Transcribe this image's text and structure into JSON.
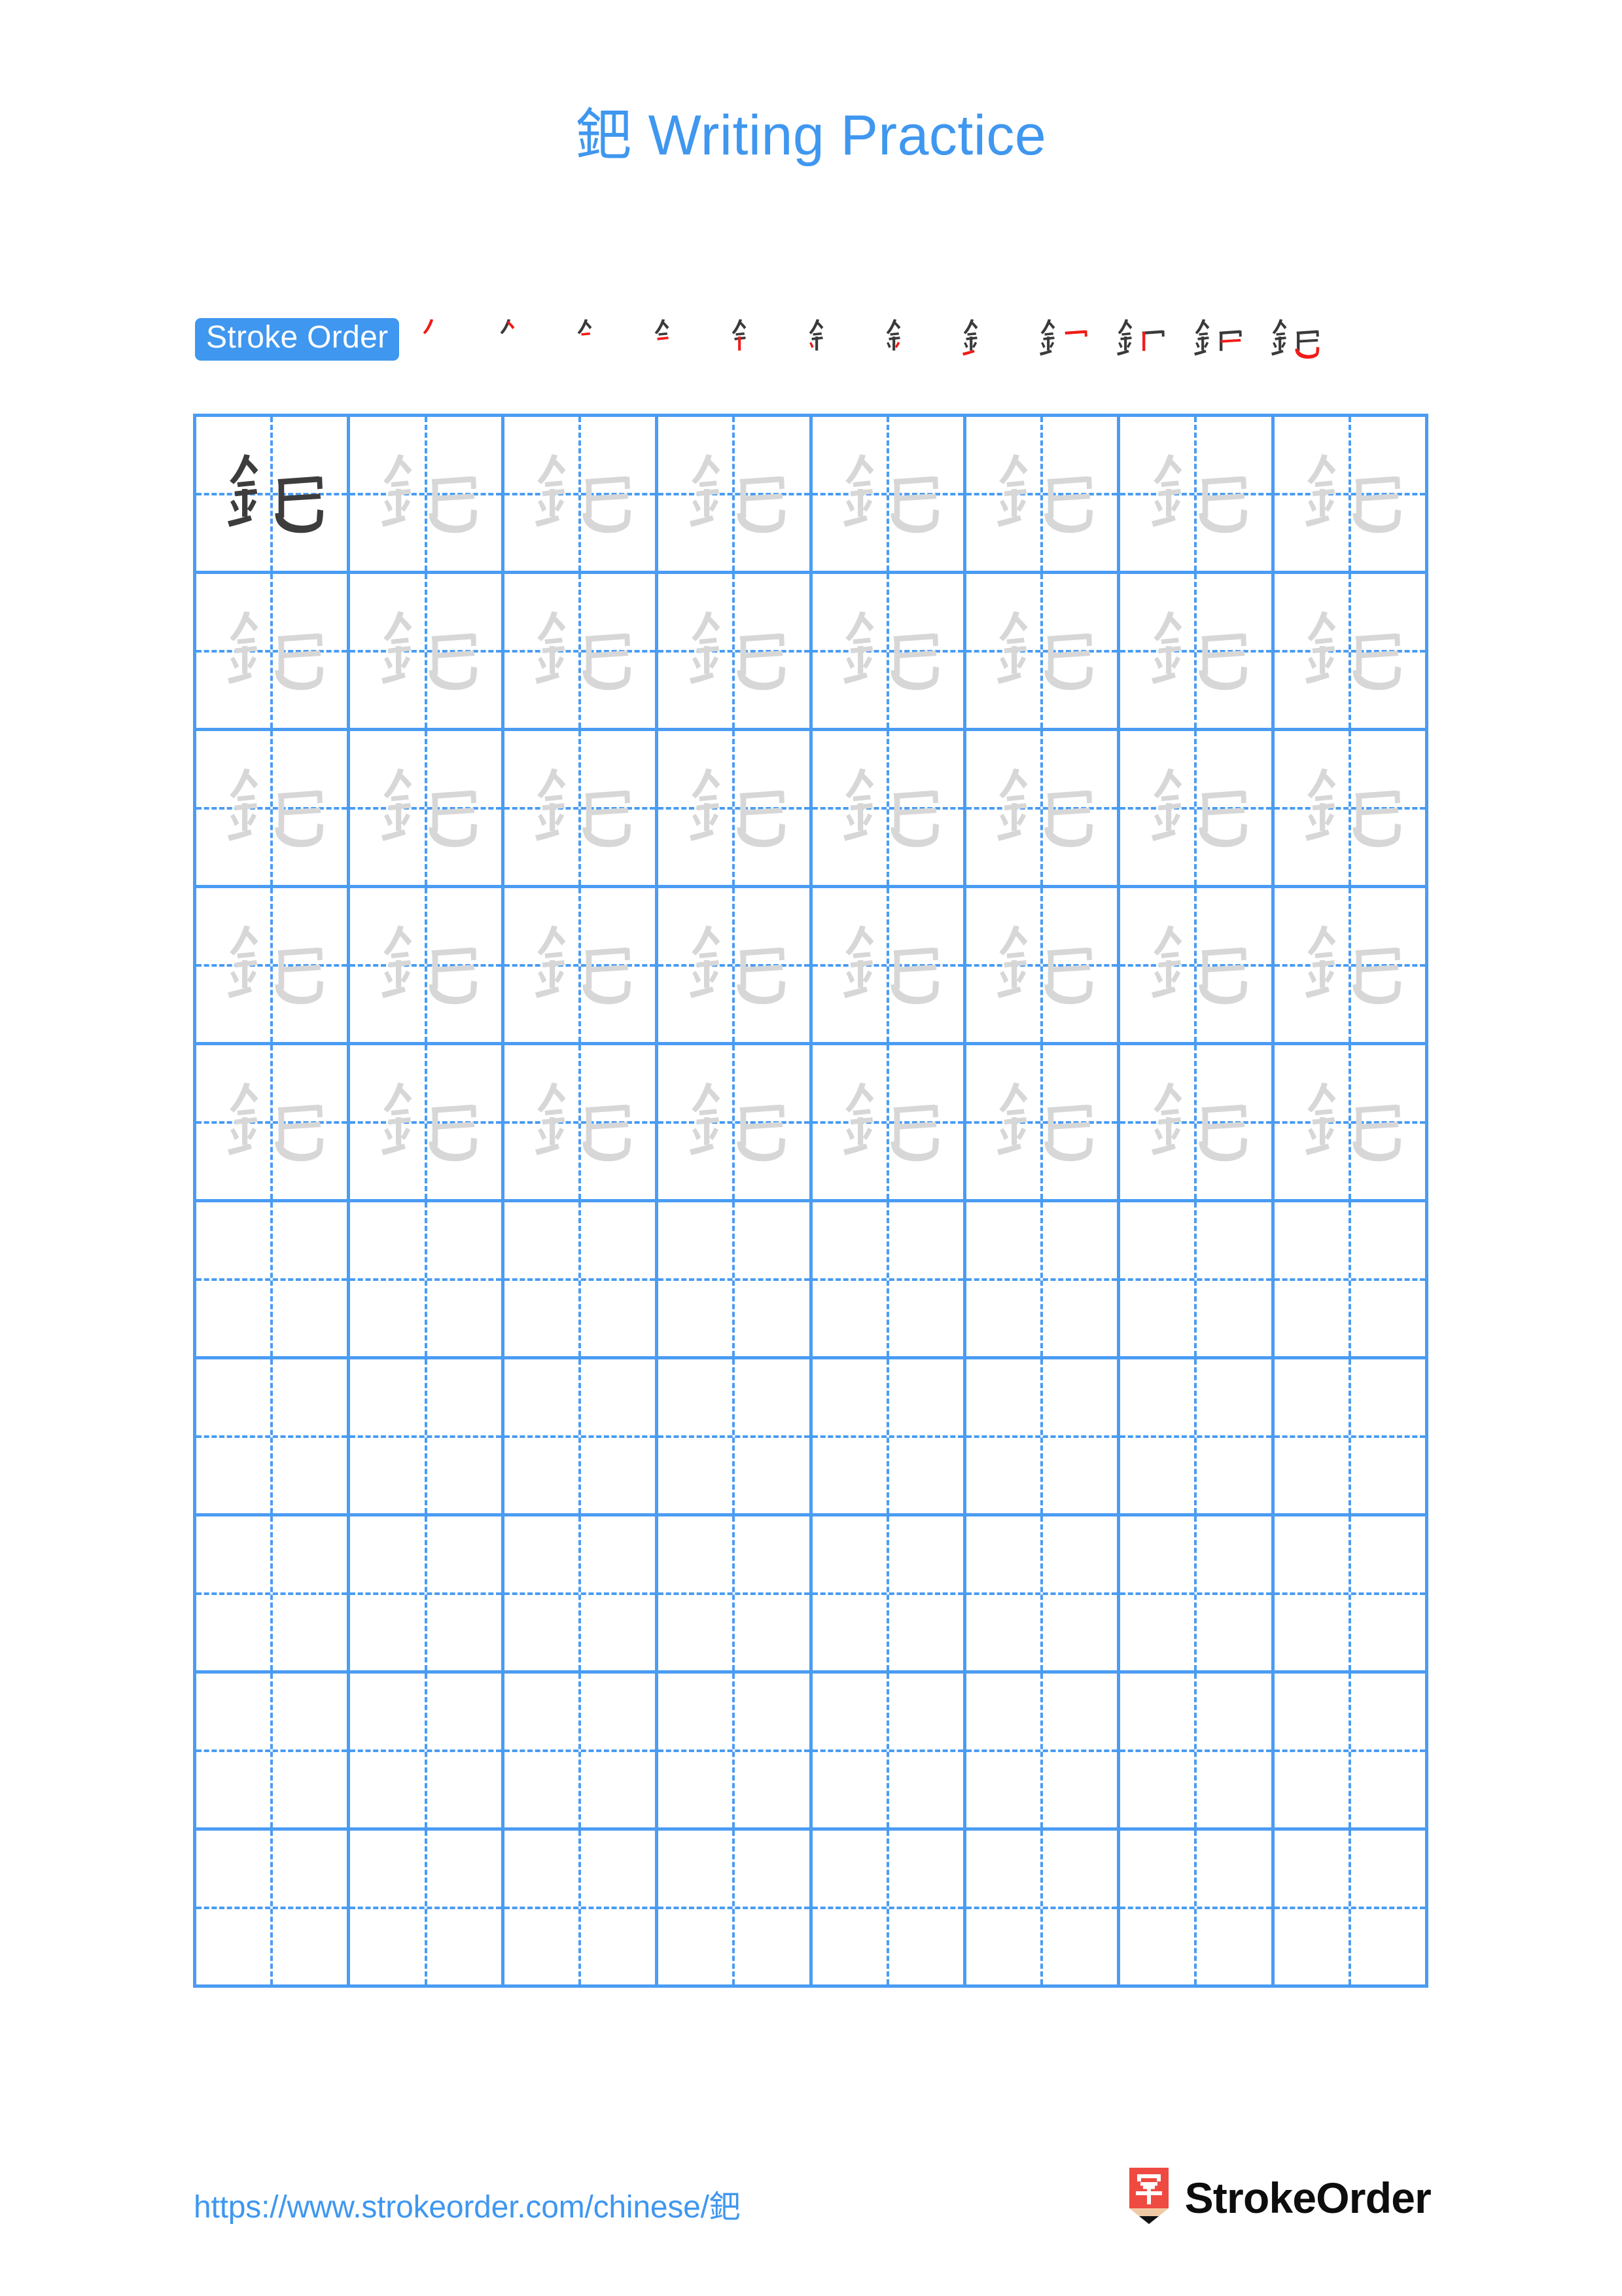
{
  "page": {
    "character": "鈀",
    "title": "鈀 Writing Practice",
    "background_color": "#ffffff",
    "accent_color": "#3f97ef",
    "grid_line_color": "#4a9cf3",
    "example_glyph_color": "#3d3d3d",
    "trace_glyph_color": "#d7d7d7",
    "new_stroke_color": "#ef1c17",
    "drawn_stroke_color": "#3a3a3a"
  },
  "stroke_order": {
    "badge_label": "Stroke Order",
    "total_strokes": 12,
    "steps": [
      {
        "index": 1,
        "strokes_drawn": 1,
        "new_stroke_index": 1
      },
      {
        "index": 2,
        "strokes_drawn": 2,
        "new_stroke_index": 2
      },
      {
        "index": 3,
        "strokes_drawn": 3,
        "new_stroke_index": 3
      },
      {
        "index": 4,
        "strokes_drawn": 4,
        "new_stroke_index": 4
      },
      {
        "index": 5,
        "strokes_drawn": 5,
        "new_stroke_index": 5
      },
      {
        "index": 6,
        "strokes_drawn": 6,
        "new_stroke_index": 6
      },
      {
        "index": 7,
        "strokes_drawn": 7,
        "new_stroke_index": 7
      },
      {
        "index": 8,
        "strokes_drawn": 8,
        "new_stroke_index": 8
      },
      {
        "index": 9,
        "strokes_drawn": 9,
        "new_stroke_index": 9
      },
      {
        "index": 10,
        "strokes_drawn": 10,
        "new_stroke_index": 10
      },
      {
        "index": 11,
        "strokes_drawn": 11,
        "new_stroke_index": 11
      },
      {
        "index": 12,
        "strokes_drawn": 12,
        "new_stroke_index": 12
      }
    ]
  },
  "practice_grid": {
    "columns": 8,
    "rows": 10,
    "cells": [
      [
        "example",
        "trace",
        "trace",
        "trace",
        "trace",
        "trace",
        "trace",
        "trace"
      ],
      [
        "trace",
        "trace",
        "trace",
        "trace",
        "trace",
        "trace",
        "trace",
        "trace"
      ],
      [
        "trace",
        "trace",
        "trace",
        "trace",
        "trace",
        "trace",
        "trace",
        "trace"
      ],
      [
        "trace",
        "trace",
        "trace",
        "trace",
        "trace",
        "trace",
        "trace",
        "trace"
      ],
      [
        "trace",
        "trace",
        "trace",
        "trace",
        "trace",
        "trace",
        "trace",
        "trace"
      ],
      [
        "empty",
        "empty",
        "empty",
        "empty",
        "empty",
        "empty",
        "empty",
        "empty"
      ],
      [
        "empty",
        "empty",
        "empty",
        "empty",
        "empty",
        "empty",
        "empty",
        "empty"
      ],
      [
        "empty",
        "empty",
        "empty",
        "empty",
        "empty",
        "empty",
        "empty",
        "empty"
      ],
      [
        "empty",
        "empty",
        "empty",
        "empty",
        "empty",
        "empty",
        "empty",
        "empty"
      ],
      [
        "empty",
        "empty",
        "empty",
        "empty",
        "empty",
        "empty",
        "empty",
        "empty"
      ]
    ]
  },
  "footer": {
    "url": "https://www.strokeorder.com/chinese/鈀",
    "brand_name": "StrokeOrder",
    "logo_character": "字",
    "logo_body_color": "#ef4a42",
    "logo_wood_color": "#efc9a4",
    "logo_tip_color": "#111111"
  }
}
